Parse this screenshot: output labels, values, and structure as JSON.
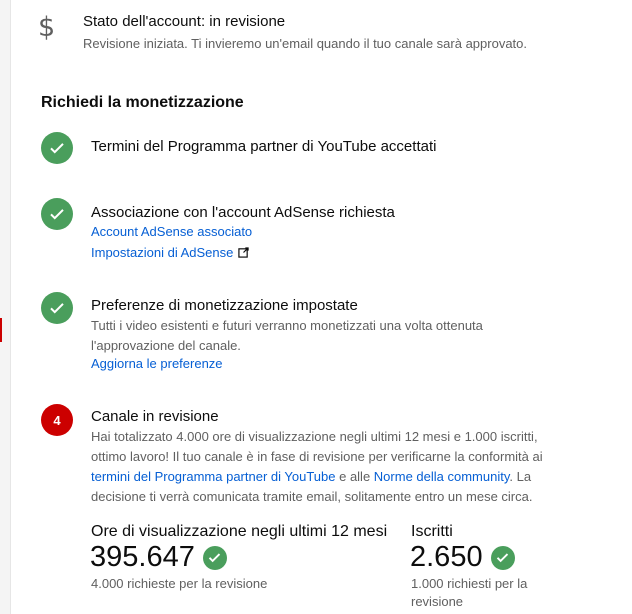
{
  "account": {
    "icon": "dollar-icon",
    "status": "Stato dell'account: in revisione",
    "subtitle": "Revisione iniziata. Ti invieremo un'email quando il tuo canale sarà approvato."
  },
  "section_title": "Richiedi la monetizzazione",
  "steps": [
    {
      "status": "done",
      "title": "Termini del Programma partner di YouTube accettati"
    },
    {
      "status": "done",
      "title": "Associazione con l'account AdSense richiesta",
      "links": [
        "Account AdSense associato",
        "Impostazioni di AdSense"
      ]
    },
    {
      "status": "done",
      "title": "Preferenze di monetizzazione impostate",
      "text_line1": "Tutti i video esistenti e futuri verranno monetizzati una volta ottenuta",
      "text_line2": "l'approvazione del canale.",
      "link": "Aggiorna le preferenze"
    },
    {
      "status": "in_review",
      "number": "4",
      "title": "Canale in revisione",
      "text": {
        "line1": "Hai totalizzato 4.000 ore di visualizzazione negli ultimi 12 mesi e 1.000 iscritti,",
        "line2": "ottimo lavoro! Il tuo canale è in fase di revisione per verificarne la conformità ai",
        "line3_link1": "termini del Programma partner di YouTube",
        "line3_mid": " e alle ",
        "line3_link2": "Norme della community",
        "line3_end": ". La",
        "line4": "decisione ti verrà comunicata tramite email, solitamente entro un mese circa."
      }
    }
  ],
  "stats": {
    "watch_hours": {
      "label": "Ore di visualizzazione negli ultimi 12 mesi",
      "value": "395.647",
      "note": "4.000 richieste per la revisione"
    },
    "subscribers": {
      "label": "Iscritti",
      "value": "2.650",
      "note_line1": "1.000 richiesti per la",
      "note_line2": "revisione"
    }
  },
  "colors": {
    "success": "#4a9e5c",
    "alert": "#cc0000",
    "link": "#065fd4",
    "secondary_text": "#606060"
  }
}
